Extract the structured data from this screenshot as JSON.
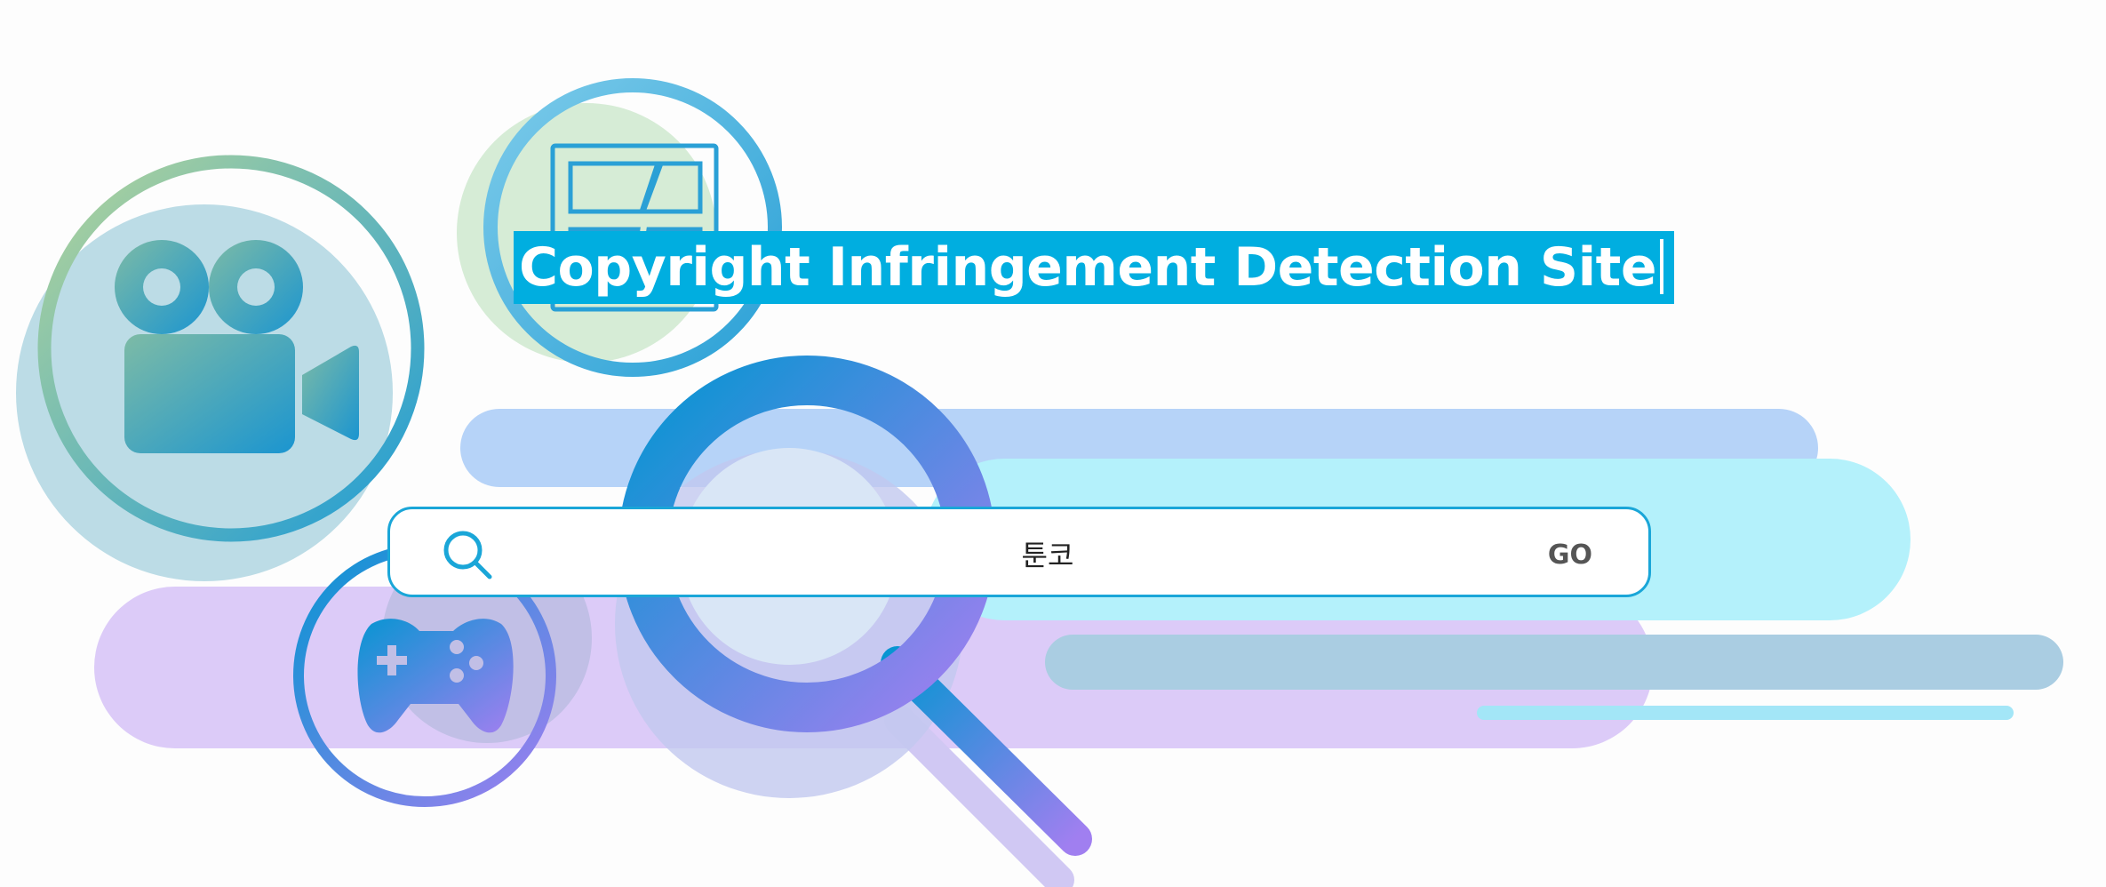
{
  "headline": {
    "title": "Copyright Infringement Detection Site"
  },
  "search": {
    "value": "툰코",
    "placeholder": "",
    "go_label": "GO"
  },
  "icons": [
    "movie-camera-icon",
    "comic-panel-icon",
    "magnifier-icon",
    "gamepad-icon",
    "search-icon"
  ],
  "colors": {
    "accent": "#00aee0",
    "search_border": "#1aa6d8",
    "go_text": "#555555",
    "purple_band": "#dccbf8",
    "blue_band": "#b6d3f8",
    "cyan_band": "#b4f1fb"
  }
}
